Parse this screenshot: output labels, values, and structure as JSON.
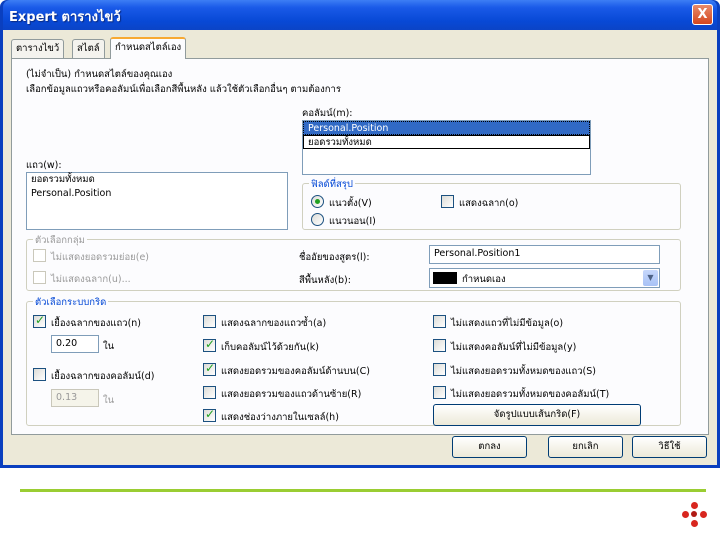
{
  "window": {
    "title": "Expert ตารางไขว้",
    "close_label": "X"
  },
  "tabs": [
    {
      "label": "ตารางไขว้"
    },
    {
      "label": "สไตล์"
    },
    {
      "label": "กำหนดสไตล์เอง"
    }
  ],
  "intro": {
    "line1": "(ไม่จำเป็น) กำหนดสไตล์ของคุณเอง",
    "line2": "เลือกข้อมูลแถวหรือคอลัมน์เพื่อเลือกสีพื้นหลัง แล้วใช้ตัวเลือกอื่นๆ ตามต้องการ"
  },
  "columns": {
    "label": "คอลัมน์(m):",
    "items": [
      "Personal.Position",
      "ยอดรวมทั้งหมด"
    ]
  },
  "rows": {
    "label": "แถว(w):",
    "items": [
      "ยอดรวมทั้งหมด",
      "Personal.Position"
    ]
  },
  "summary_fields": {
    "legend": "ฟิลด์ที่สรุป",
    "vertical": "แนวตั้ง(V)",
    "horizontal": "แนวนอน(I)",
    "show_label": "แสดงฉลาก(o)"
  },
  "grouping": {
    "legend": "ตัวเลือกกลุ่ม",
    "hide_group": "ไม่แสดงยอดรวมย่อย(e)",
    "hide_label": "ไม่แสดงฉลาก(u)...",
    "alias_label": "ชื่ออัยของสูตร(l):",
    "alias_value": "Personal.Position1",
    "bg_label": "สีพื้นหลัง(b):",
    "bg_value": "กำหนดเอง",
    "bg_color": "#000000"
  },
  "grid": {
    "legend": "ตัวเลือกระบบกริด",
    "indent_rows": "เยื้องฉลากของแถว(n)",
    "indent_rows_value": "0.20",
    "indent_rows_unit": "ใน",
    "indent_cols": "เยื้องฉลากของคอลัมน์(d)",
    "indent_cols_value": "0.13",
    "indent_cols_unit": "ใน",
    "opt1": "แสดงฉลากของแถวซ้ำ(a)",
    "opt2": "เก็บคอลัมน์ไว้ด้วยกัน(k)",
    "opt3": "แสดงยอดรวมของคอลัมน์ด้านบน(C)",
    "opt4": "แสดงยอดรวมของแถวด้านซ้าย(R)",
    "opt5": "แสดงช่องว่างภายในเซลล์(h)",
    "opt6": "ไม่แสดงแถวที่ไม่มีข้อมูล(o)",
    "opt7": "ไม่แสดงคอลัมน์ที่ไม่มีข้อมูล(y)",
    "opt8": "ไม่แสดงยอดรวมทั้งหมดของแถว(S)",
    "opt9": "ไม่แสดงยอดรวมทั้งหมดของคอลัมน์(T)",
    "format_button": "จัดรูปแบบเส้นกริด(F)"
  },
  "footer": {
    "ok": "ตกลง",
    "cancel": "ยกเลิก",
    "help": "วิธีใช้"
  },
  "colors": {
    "accent_line": "#9acd32",
    "logo": "#d8261f"
  }
}
